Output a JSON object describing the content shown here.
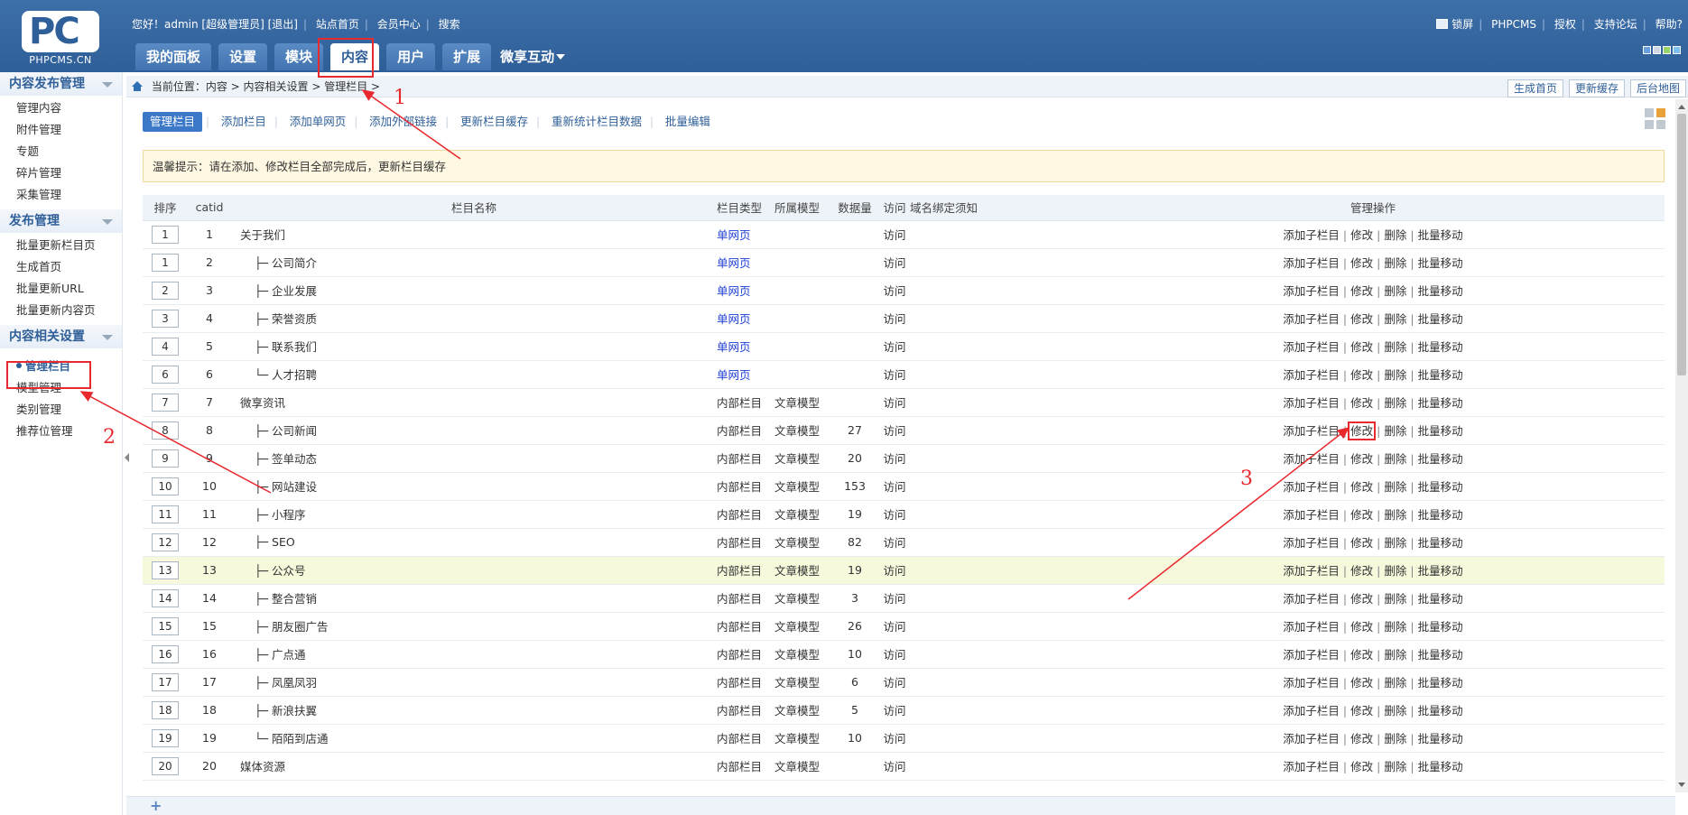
{
  "header": {
    "logo_text": "PC",
    "logo_sub": "PHPCMS.CN",
    "greeting": "您好！admin [超级管理员]",
    "logout": "[退出]",
    "site_home": "站点首页",
    "member_center": "会员中心",
    "search": "搜索",
    "lock_screen": "锁屏",
    "phpcms": "PHPCMS",
    "license": "授权",
    "forum": "支持论坛",
    "help": "帮助?"
  },
  "nav": {
    "tabs": [
      "我的面板",
      "设置",
      "模块",
      "内容",
      "用户",
      "扩展"
    ],
    "active": "内容",
    "dropdown": "微享互动"
  },
  "sidebar": {
    "sections": [
      {
        "title": "内容发布管理",
        "items": [
          "管理内容",
          "附件管理",
          "专题",
          "碎片管理",
          "采集管理"
        ]
      },
      {
        "title": "发布管理",
        "items": [
          "批量更新栏目页",
          "生成首页",
          "批量更新URL",
          "批量更新内容页"
        ]
      },
      {
        "title": "内容相关设置",
        "items": [
          "管理栏目",
          "模型管理",
          "类别管理",
          "推荐位管理"
        ]
      }
    ],
    "current": "管理栏目"
  },
  "breadcrumb": {
    "text": "当前位置：内容 > 内容相关设置 > 管理栏目 >",
    "actions": [
      "生成首页",
      "更新缓存",
      "后台地图"
    ]
  },
  "subnav": [
    "管理栏目",
    "添加栏目",
    "添加单网页",
    "添加外部链接",
    "更新栏目缓存",
    "重新统计栏目数据",
    "批量编辑"
  ],
  "tip": "温馨提示：请在添加、修改栏目全部完成后，更新栏目缓存",
  "table": {
    "headers": [
      "排序",
      "catid",
      "栏目名称",
      "栏目类型",
      "所属模型",
      "数据量",
      "访问",
      "域名绑定须知",
      "管理操作"
    ],
    "ops": [
      "添加子栏目",
      "修改",
      "删除",
      "批量移动"
    ],
    "rows": [
      {
        "order": "1",
        "catid": "1",
        "name": "关于我们",
        "type": "单网页",
        "model": "",
        "count": "",
        "visit": "访问"
      },
      {
        "order": "1",
        "catid": "2",
        "name": "├─ 公司简介",
        "type": "单网页",
        "model": "",
        "count": "",
        "visit": "访问"
      },
      {
        "order": "2",
        "catid": "3",
        "name": "├─ 企业发展",
        "type": "单网页",
        "model": "",
        "count": "",
        "visit": "访问"
      },
      {
        "order": "3",
        "catid": "4",
        "name": "├─ 荣誉资质",
        "type": "单网页",
        "model": "",
        "count": "",
        "visit": "访问"
      },
      {
        "order": "4",
        "catid": "5",
        "name": "├─ 联系我们",
        "type": "单网页",
        "model": "",
        "count": "",
        "visit": "访问"
      },
      {
        "order": "6",
        "catid": "6",
        "name": "└─ 人才招聘",
        "type": "单网页",
        "model": "",
        "count": "",
        "visit": "访问"
      },
      {
        "order": "7",
        "catid": "7",
        "name": "微享资讯",
        "type": "内部栏目",
        "model": "文章模型",
        "count": "",
        "visit": "访问"
      },
      {
        "order": "8",
        "catid": "8",
        "name": "├─ 公司新闻",
        "type": "内部栏目",
        "model": "文章模型",
        "count": "27",
        "visit": "访问"
      },
      {
        "order": "9",
        "catid": "9",
        "name": "├─ 签单动态",
        "type": "内部栏目",
        "model": "文章模型",
        "count": "20",
        "visit": "访问"
      },
      {
        "order": "10",
        "catid": "10",
        "name": "├─ 网站建设",
        "type": "内部栏目",
        "model": "文章模型",
        "count": "153",
        "visit": "访问"
      },
      {
        "order": "11",
        "catid": "11",
        "name": "├─ 小程序",
        "type": "内部栏目",
        "model": "文章模型",
        "count": "19",
        "visit": "访问"
      },
      {
        "order": "12",
        "catid": "12",
        "name": "├─ SEO",
        "type": "内部栏目",
        "model": "文章模型",
        "count": "82",
        "visit": "访问"
      },
      {
        "order": "13",
        "catid": "13",
        "name": "├─ 公众号",
        "type": "内部栏目",
        "model": "文章模型",
        "count": "19",
        "visit": "访问"
      },
      {
        "order": "14",
        "catid": "14",
        "name": "├─ 整合营销",
        "type": "内部栏目",
        "model": "文章模型",
        "count": "3",
        "visit": "访问"
      },
      {
        "order": "15",
        "catid": "15",
        "name": "├─ 朋友圈广告",
        "type": "内部栏目",
        "model": "文章模型",
        "count": "26",
        "visit": "访问"
      },
      {
        "order": "16",
        "catid": "16",
        "name": "├─ 广点通",
        "type": "内部栏目",
        "model": "文章模型",
        "count": "10",
        "visit": "访问"
      },
      {
        "order": "17",
        "catid": "17",
        "name": "├─ 凤凰凤羽",
        "type": "内部栏目",
        "model": "文章模型",
        "count": "6",
        "visit": "访问"
      },
      {
        "order": "18",
        "catid": "18",
        "name": "├─ 新浪扶翼",
        "type": "内部栏目",
        "model": "文章模型",
        "count": "5",
        "visit": "访问"
      },
      {
        "order": "19",
        "catid": "19",
        "name": "└─ 陌陌到店通",
        "type": "内部栏目",
        "model": "文章模型",
        "count": "10",
        "visit": "访问"
      },
      {
        "order": "20",
        "catid": "20",
        "name": "媒体资源",
        "type": "内部栏目",
        "model": "文章模型",
        "count": "",
        "visit": "访问"
      }
    ]
  },
  "annotations": {
    "labels": [
      "1",
      "2",
      "3"
    ],
    "color": "#e8292e"
  },
  "colors": {
    "header_blue": "#2f5f98",
    "link_blue": "#1f3fd8",
    "tip_bg": "#fff8e2",
    "highlight_row": "#f6f9dc"
  }
}
